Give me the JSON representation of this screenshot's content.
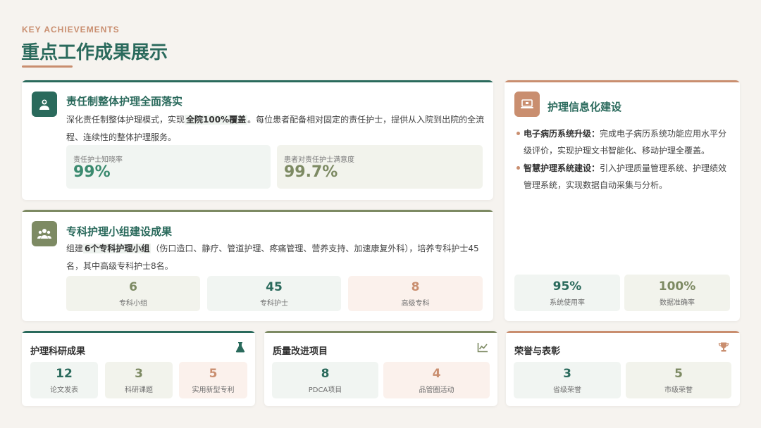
{
  "header": {
    "eyebrow": "KEY ACHIEVEMENTS",
    "title": "重点工作成果展示"
  },
  "colors": {
    "green": "#2a6a5c",
    "olive": "#7d8a63",
    "copper": "#c98e6f",
    "value_green": "#3b8a6f",
    "value_olive": "#7d8a63",
    "value_copper": "#c98e6f"
  },
  "card1": {
    "icon": "nurse-icon",
    "title": "责任制整体护理全面落实",
    "desc_pre": "深化责任制整体护理模式，实现",
    "desc_bold": "全院100%覆盖",
    "desc_post": "。每位患者配备相对固定的责任护士，提供从入院到出院的全流程、连续性的整体护理服务。",
    "stats": [
      {
        "label": "责任护士知晓率",
        "value": "99%"
      },
      {
        "label": "患者对责任护士满意度",
        "value": "99.7%"
      }
    ]
  },
  "card2": {
    "icon": "team-icon",
    "title": "专科护理小组建设成果",
    "desc_pre": "组建",
    "desc_bold": "6个专科护理小组",
    "desc_post": "（伤口造口、静疗、管道护理、疼痛管理、营养支持、加速康复外科），培养专科护士45名，其中高级专科护士8名。",
    "stats": [
      {
        "value": "6",
        "label": "专科小组"
      },
      {
        "value": "45",
        "label": "专科护士"
      },
      {
        "value": "8",
        "label": "高级专科"
      }
    ]
  },
  "card3": {
    "icon": "laptop-icon",
    "title": "护理信息化建设",
    "bullets": [
      {
        "bold": "电子病历系统升级：",
        "text": "完成电子病历系统功能应用水平分级评价，实现护理文书智能化、移动护理全覆盖。"
      },
      {
        "bold": "智慧护理系统建设：",
        "text": "引入护理质量管理系统、护理绩效管理系统，实现数据自动采集与分析。"
      }
    ],
    "stats": [
      {
        "value": "95%",
        "label": "系统使用率"
      },
      {
        "value": "100%",
        "label": "数据准确率"
      }
    ]
  },
  "card4": {
    "icon": "flask-icon",
    "title": "护理科研成果",
    "stats": [
      {
        "value": "12",
        "label": "论文发表"
      },
      {
        "value": "3",
        "label": "科研课题"
      },
      {
        "value": "5",
        "label": "实用新型专利"
      }
    ]
  },
  "card5": {
    "icon": "chart-line-icon",
    "title": "质量改进项目",
    "stats": [
      {
        "value": "8",
        "label": "PDCA项目"
      },
      {
        "value": "4",
        "label": "品管圈活动"
      }
    ]
  },
  "card6": {
    "icon": "trophy-icon",
    "title": "荣誉与表彰",
    "stats": [
      {
        "value": "3",
        "label": "省级荣誉"
      },
      {
        "value": "5",
        "label": "市级荣誉"
      }
    ]
  }
}
